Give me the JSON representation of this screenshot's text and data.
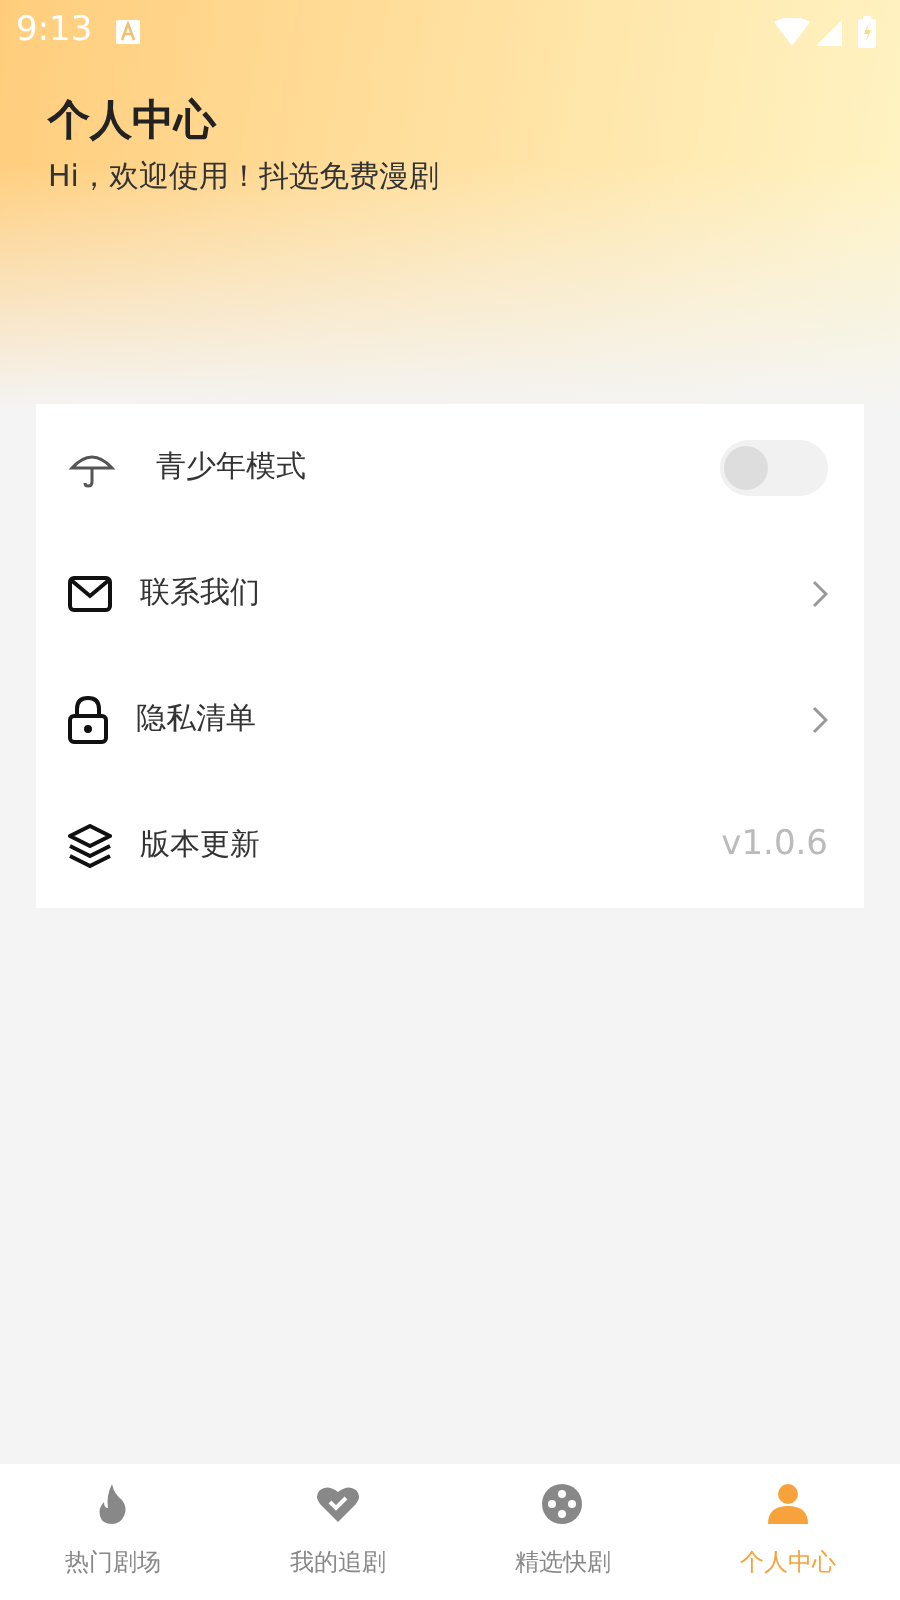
{
  "status_bar": {
    "time": "9:13"
  },
  "header": {
    "title": "个人中心",
    "subtitle": "Hi，欢迎使用！抖选免费漫剧"
  },
  "menu": [
    {
      "kind": "toggle",
      "label": "青少年模式",
      "on": false
    },
    {
      "kind": "link",
      "label": "联系我们"
    },
    {
      "kind": "link",
      "label": "隐私清单"
    },
    {
      "kind": "value",
      "label": "版本更新",
      "value": "v1.0.6"
    }
  ],
  "tabs": [
    {
      "label": "热门剧场",
      "selected": false
    },
    {
      "label": "我的追剧",
      "selected": false
    },
    {
      "label": "精选快剧",
      "selected": false
    },
    {
      "label": "个人中心",
      "selected": true
    }
  ]
}
